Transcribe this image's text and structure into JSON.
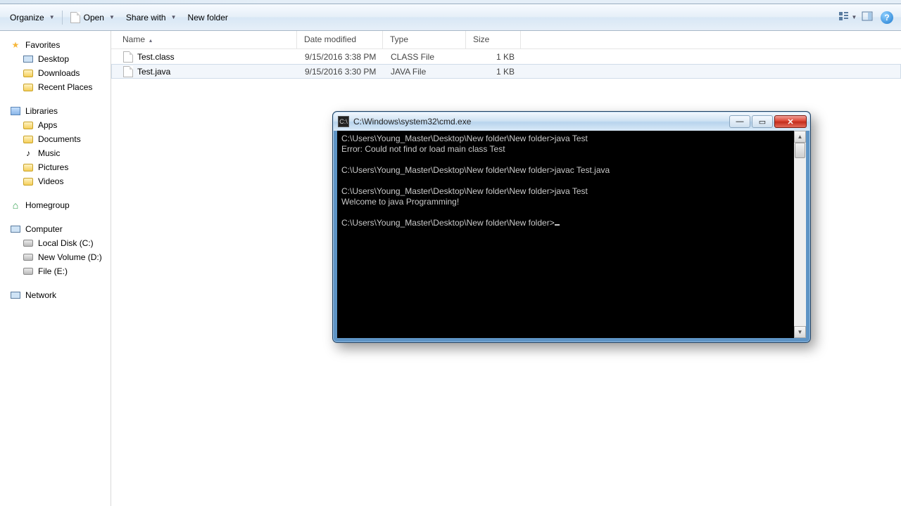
{
  "toolbar": {
    "organize": "Organize",
    "open": "Open",
    "share": "Share with",
    "newfolder": "New folder"
  },
  "sidebar": {
    "favorites": "Favorites",
    "fav_items": [
      "Desktop",
      "Downloads",
      "Recent Places"
    ],
    "libraries": "Libraries",
    "lib_items": [
      "Apps",
      "Documents",
      "Music",
      "Pictures",
      "Videos"
    ],
    "homegroup": "Homegroup",
    "computer": "Computer",
    "comp_items": [
      "Local Disk (C:)",
      "New Volume (D:)",
      "File (E:)"
    ],
    "network": "Network"
  },
  "columns": {
    "name": "Name",
    "date": "Date modified",
    "type": "Type",
    "size": "Size"
  },
  "files": [
    {
      "name": "Test.class",
      "date": "9/15/2016 3:38 PM",
      "type": "CLASS File",
      "size": "1 KB"
    },
    {
      "name": "Test.java",
      "date": "9/15/2016 3:30 PM",
      "type": "JAVA File",
      "size": "1 KB"
    }
  ],
  "cmd": {
    "title": "C:\\Windows\\system32\\cmd.exe",
    "lines": [
      "C:\\Users\\Young_Master\\Desktop\\New folder\\New folder>java Test",
      "Error: Could not find or load main class Test",
      "",
      "C:\\Users\\Young_Master\\Desktop\\New folder\\New folder>javac Test.java",
      "",
      "C:\\Users\\Young_Master\\Desktop\\New folder\\New folder>java Test",
      "Welcome to java Programming!",
      "",
      "C:\\Users\\Young_Master\\Desktop\\New folder\\New folder>"
    ]
  }
}
